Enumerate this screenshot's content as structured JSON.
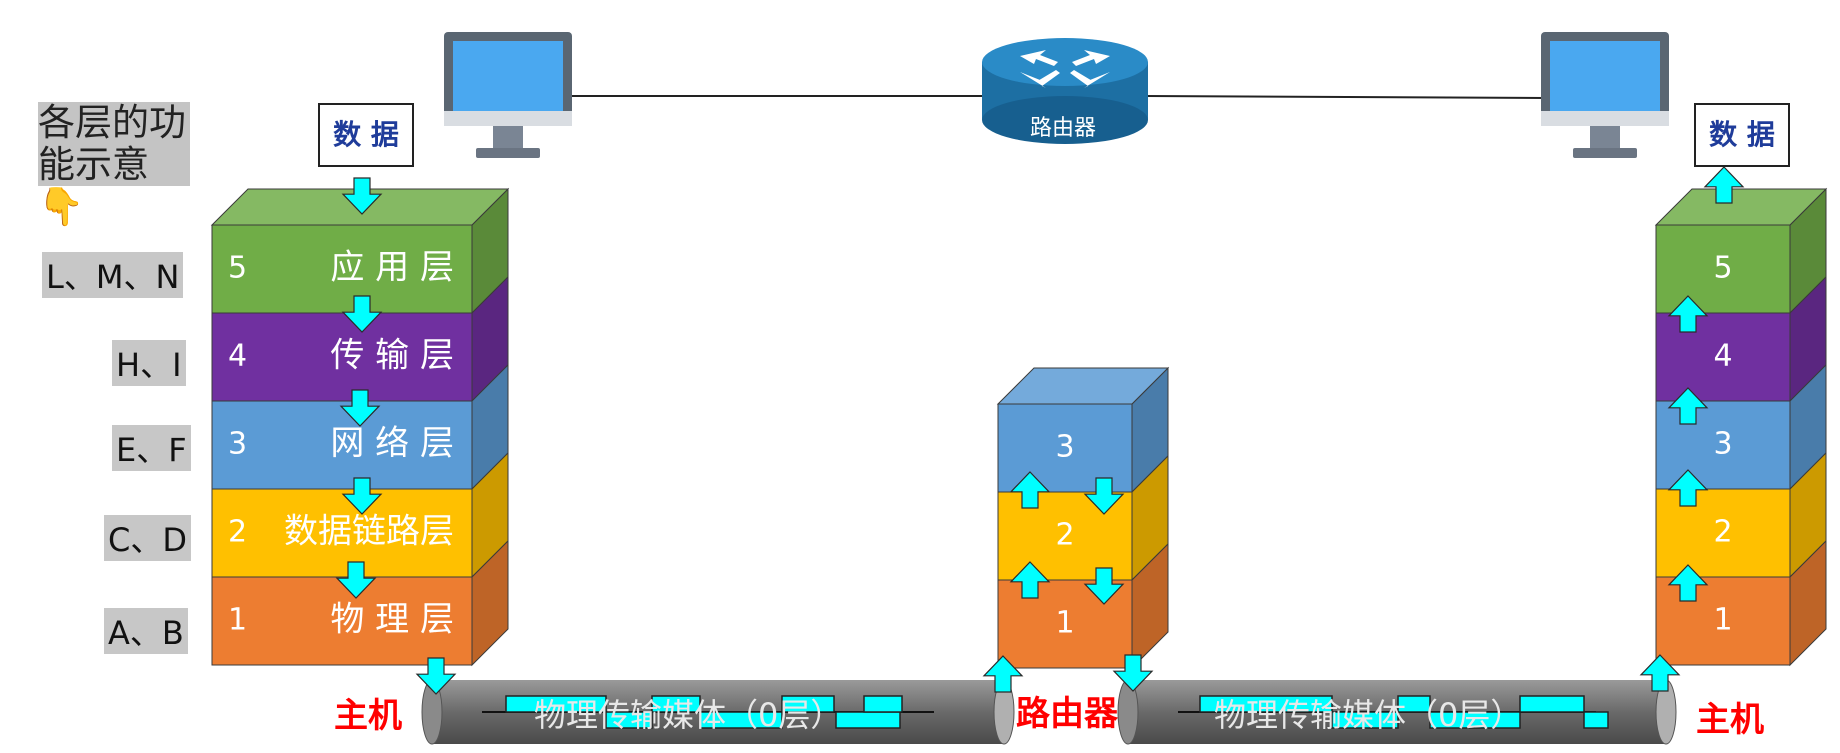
{
  "title": "各层的功能示意👇",
  "data_label": "数 据",
  "left_stack": [
    {
      "num": "5",
      "name": "应 用 层",
      "tag": "L、M、N"
    },
    {
      "num": "4",
      "name": "传 输 层",
      "tag": "H、I"
    },
    {
      "num": "3",
      "name": "网 络 层",
      "tag": "E、F"
    },
    {
      "num": "2",
      "name": "数据链路层",
      "tag": "C、D"
    },
    {
      "num": "1",
      "name": "物 理 层",
      "tag": "A、B"
    }
  ],
  "router_stack": [
    "3",
    "2",
    "1"
  ],
  "right_stack": [
    "5",
    "4",
    "3",
    "2",
    "1"
  ],
  "router_icon_label": "路由器",
  "host_left": "主机",
  "host_right": "主机",
  "router_label": "路由器",
  "medium_left": "物理传输媒体（0层）",
  "medium_right": "物理传输媒体（0层）",
  "colors": {
    "app": "#70ad47",
    "transport": "#7030a0",
    "network": "#5b9bd5",
    "datalink": "#ffc000",
    "physical": "#ed7d31",
    "arrow": "#00ffff"
  }
}
